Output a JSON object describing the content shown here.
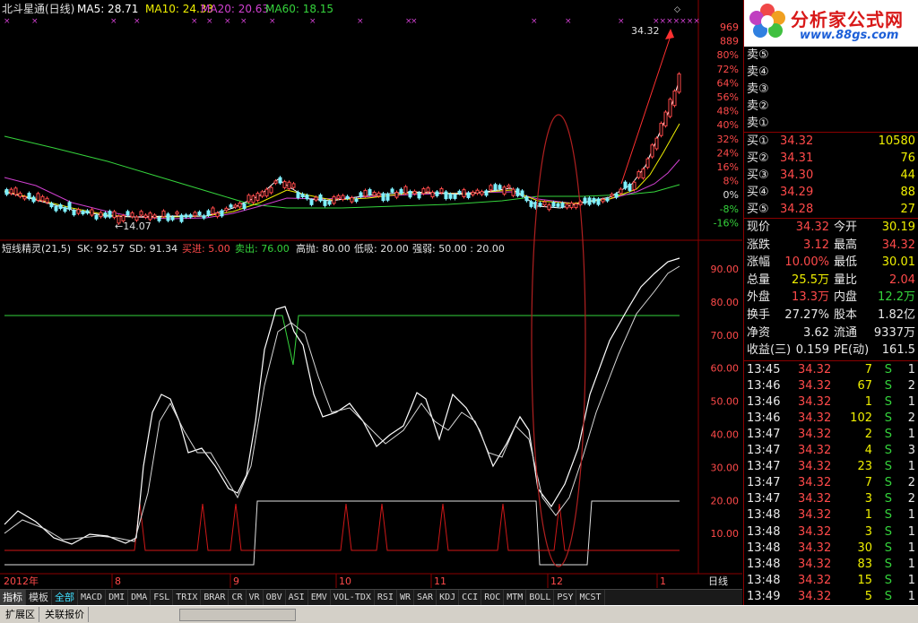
{
  "header": {
    "title": "北斗星通(日线)",
    "ma5": "MA5: 28.71",
    "ma10": "MA10: 24.33",
    "ma20": "MA20: 20.63",
    "ma60": "MA60: 18.15"
  },
  "price_labels": [
    "969",
    "889",
    "80%",
    "72%",
    "64%",
    "56%",
    "48%",
    "40%",
    "32%",
    "24%",
    "16%",
    "8%",
    "0%",
    "-8%",
    "-16%"
  ],
  "price_annotations": {
    "high": "34.32",
    "low": "14.07"
  },
  "indicator_header": {
    "name": "短线精灵(21,5)",
    "sk": "SK: 92.57",
    "sd": "SD: 91.34",
    "buy": "买进: 5.00",
    "sell": "卖出: 76.00",
    "high_throw": "高抛: 80.00",
    "low_absorb": "低吸: 20.00",
    "strong_weak": "强弱: 50.00 : 20.00"
  },
  "indicator_labels": [
    "90.00",
    "80.00",
    "70.00",
    "60.00",
    "50.00",
    "40.00",
    "30.00",
    "20.00",
    "10.00"
  ],
  "date_axis": {
    "year": "2012年",
    "months": [
      "8",
      "9",
      "10",
      "11",
      "12",
      "1"
    ],
    "period": "日线"
  },
  "zoom_controls": {
    "plus": "+",
    "minus": "-",
    "reset": "⊙"
  },
  "indicator_tabs": [
    "指标",
    "模板",
    "全部",
    "MACD",
    "DMI",
    "DMA",
    "FSL",
    "TRIX",
    "BRAR",
    "CR",
    "VR",
    "OBV",
    "ASI",
    "EMV",
    "VOL-TDX",
    "RSI",
    "WR",
    "SAR",
    "KDJ",
    "CCI",
    "ROC",
    "MTM",
    "BOLL",
    "PSY",
    "MCST"
  ],
  "bottom_tabs": [
    "扩展区",
    "关联报价"
  ],
  "logo": {
    "text": "分析家公式网",
    "url": "www.88gs.com"
  },
  "order_book": {
    "sell": [
      {
        "label": "卖⑤",
        "price": "",
        "volume": ""
      },
      {
        "label": "卖④",
        "price": "",
        "volume": ""
      },
      {
        "label": "卖③",
        "price": "",
        "volume": ""
      },
      {
        "label": "卖②",
        "price": "",
        "volume": ""
      },
      {
        "label": "卖①",
        "price": "",
        "volume": ""
      }
    ],
    "buy": [
      {
        "label": "买①",
        "price": "34.32",
        "volume": "10580"
      },
      {
        "label": "买②",
        "price": "34.31",
        "volume": "76"
      },
      {
        "label": "买③",
        "price": "34.30",
        "volume": "44"
      },
      {
        "label": "买④",
        "price": "34.29",
        "volume": "88"
      },
      {
        "label": "买⑤",
        "price": "34.28",
        "volume": "27"
      }
    ]
  },
  "quote_stats": [
    {
      "l1": "现价",
      "v1": "34.32",
      "c1": "red",
      "l2": "今开",
      "v2": "30.19",
      "c2": "yellow"
    },
    {
      "l1": "涨跌",
      "v1": "3.12",
      "c1": "red",
      "l2": "最高",
      "v2": "34.32",
      "c2": "red"
    },
    {
      "l1": "涨幅",
      "v1": "10.00%",
      "c1": "red",
      "l2": "最低",
      "v2": "30.01",
      "c2": "yellow"
    },
    {
      "l1": "总量",
      "v1": "25.5万",
      "c1": "yellow",
      "l2": "量比",
      "v2": "2.04",
      "c2": "red"
    },
    {
      "l1": "外盘",
      "v1": "13.3万",
      "c1": "red",
      "l2": "内盘",
      "v2": "12.2万",
      "c2": "green"
    },
    {
      "l1": "换手",
      "v1": "27.27%",
      "c1": "white",
      "l2": "股本",
      "v2": "1.82亿",
      "c2": "white"
    },
    {
      "l1": "净资",
      "v1": "3.62",
      "c1": "white",
      "l2": "流通",
      "v2": "9337万",
      "c2": "white"
    },
    {
      "l1": "收益(三)",
      "v1": "0.159",
      "c1": "white",
      "l2": "PE(动)",
      "v2": "161.5",
      "c2": "white"
    }
  ],
  "ticks": [
    {
      "time": "13:45",
      "price": "34.32",
      "vol": "7",
      "side": "S",
      "n": "1"
    },
    {
      "time": "13:46",
      "price": "34.32",
      "vol": "67",
      "side": "S",
      "n": "2"
    },
    {
      "time": "13:46",
      "price": "34.32",
      "vol": "1",
      "side": "S",
      "n": "1"
    },
    {
      "time": "13:46",
      "price": "34.32",
      "vol": "102",
      "side": "S",
      "n": "2"
    },
    {
      "time": "13:47",
      "price": "34.32",
      "vol": "2",
      "side": "S",
      "n": "1"
    },
    {
      "time": "13:47",
      "price": "34.32",
      "vol": "4",
      "side": "S",
      "n": "3"
    },
    {
      "time": "13:47",
      "price": "34.32",
      "vol": "23",
      "side": "S",
      "n": "1"
    },
    {
      "time": "13:47",
      "price": "34.32",
      "vol": "7",
      "side": "S",
      "n": "2"
    },
    {
      "time": "13:47",
      "price": "34.32",
      "vol": "3",
      "side": "S",
      "n": "2"
    },
    {
      "time": "13:48",
      "price": "34.32",
      "vol": "1",
      "side": "S",
      "n": "1"
    },
    {
      "time": "13:48",
      "price": "34.32",
      "vol": "3",
      "side": "S",
      "n": "1"
    },
    {
      "time": "13:48",
      "price": "34.32",
      "vol": "30",
      "side": "S",
      "n": "1"
    },
    {
      "time": "13:48",
      "price": "34.32",
      "vol": "83",
      "side": "S",
      "n": "1"
    },
    {
      "time": "13:48",
      "price": "34.32",
      "vol": "15",
      "side": "S",
      "n": "1"
    },
    {
      "time": "13:49",
      "price": "34.32",
      "vol": "5",
      "side": "S",
      "n": "1"
    }
  ],
  "right_tabs": [
    "笔",
    "价",
    "细",
    "盘",
    "势",
    "指",
    "值",
    "筹"
  ],
  "colors": {
    "up": "#ff4a4a",
    "down": "#35d43c",
    "ma5": "#ffffff",
    "ma10": "#f0f000",
    "ma20": "#d040d0",
    "ma60": "#35d43c",
    "grid": "#8b0000"
  }
}
